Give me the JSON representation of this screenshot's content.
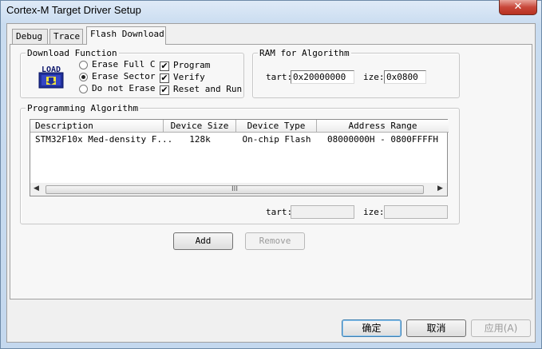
{
  "window": {
    "title": "Cortex-M Target Driver Setup",
    "close_label": "✕"
  },
  "tabs": [
    {
      "label": "Debug"
    },
    {
      "label": "Trace"
    },
    {
      "label": "Flash Download"
    }
  ],
  "download_function": {
    "legend": "Download Function",
    "logo_text": "LOAD",
    "erase_options": [
      {
        "label": "Erase Full C",
        "selected": false
      },
      {
        "label": "Erase Sector",
        "selected": true
      },
      {
        "label": "Do not Erase",
        "selected": false
      }
    ],
    "checks": [
      {
        "label": "Program",
        "checked": true
      },
      {
        "label": "Verify",
        "checked": true
      },
      {
        "label": "Reset and Run",
        "checked": true
      }
    ]
  },
  "ram": {
    "legend": "RAM for Algorithm",
    "start_label": "tart:",
    "start_value": "0x20000000",
    "size_label": "ize:",
    "size_value": "0x0800"
  },
  "programming": {
    "legend": "Programming Algorithm",
    "columns": [
      "Description",
      "Device Size",
      "Device Type",
      "Address Range"
    ],
    "rows": [
      [
        "STM32F10x Med-density F...",
        "128k",
        "On-chip Flash",
        "08000000H - 0800FFFFH"
      ]
    ],
    "scroll_grip": "III",
    "start_label": "tart:",
    "start_value": "",
    "size_label": "ize:",
    "size_value": ""
  },
  "buttons": {
    "add": "Add",
    "remove": "Remove",
    "ok": "确定",
    "cancel": "取消",
    "apply": "应用(A)"
  }
}
